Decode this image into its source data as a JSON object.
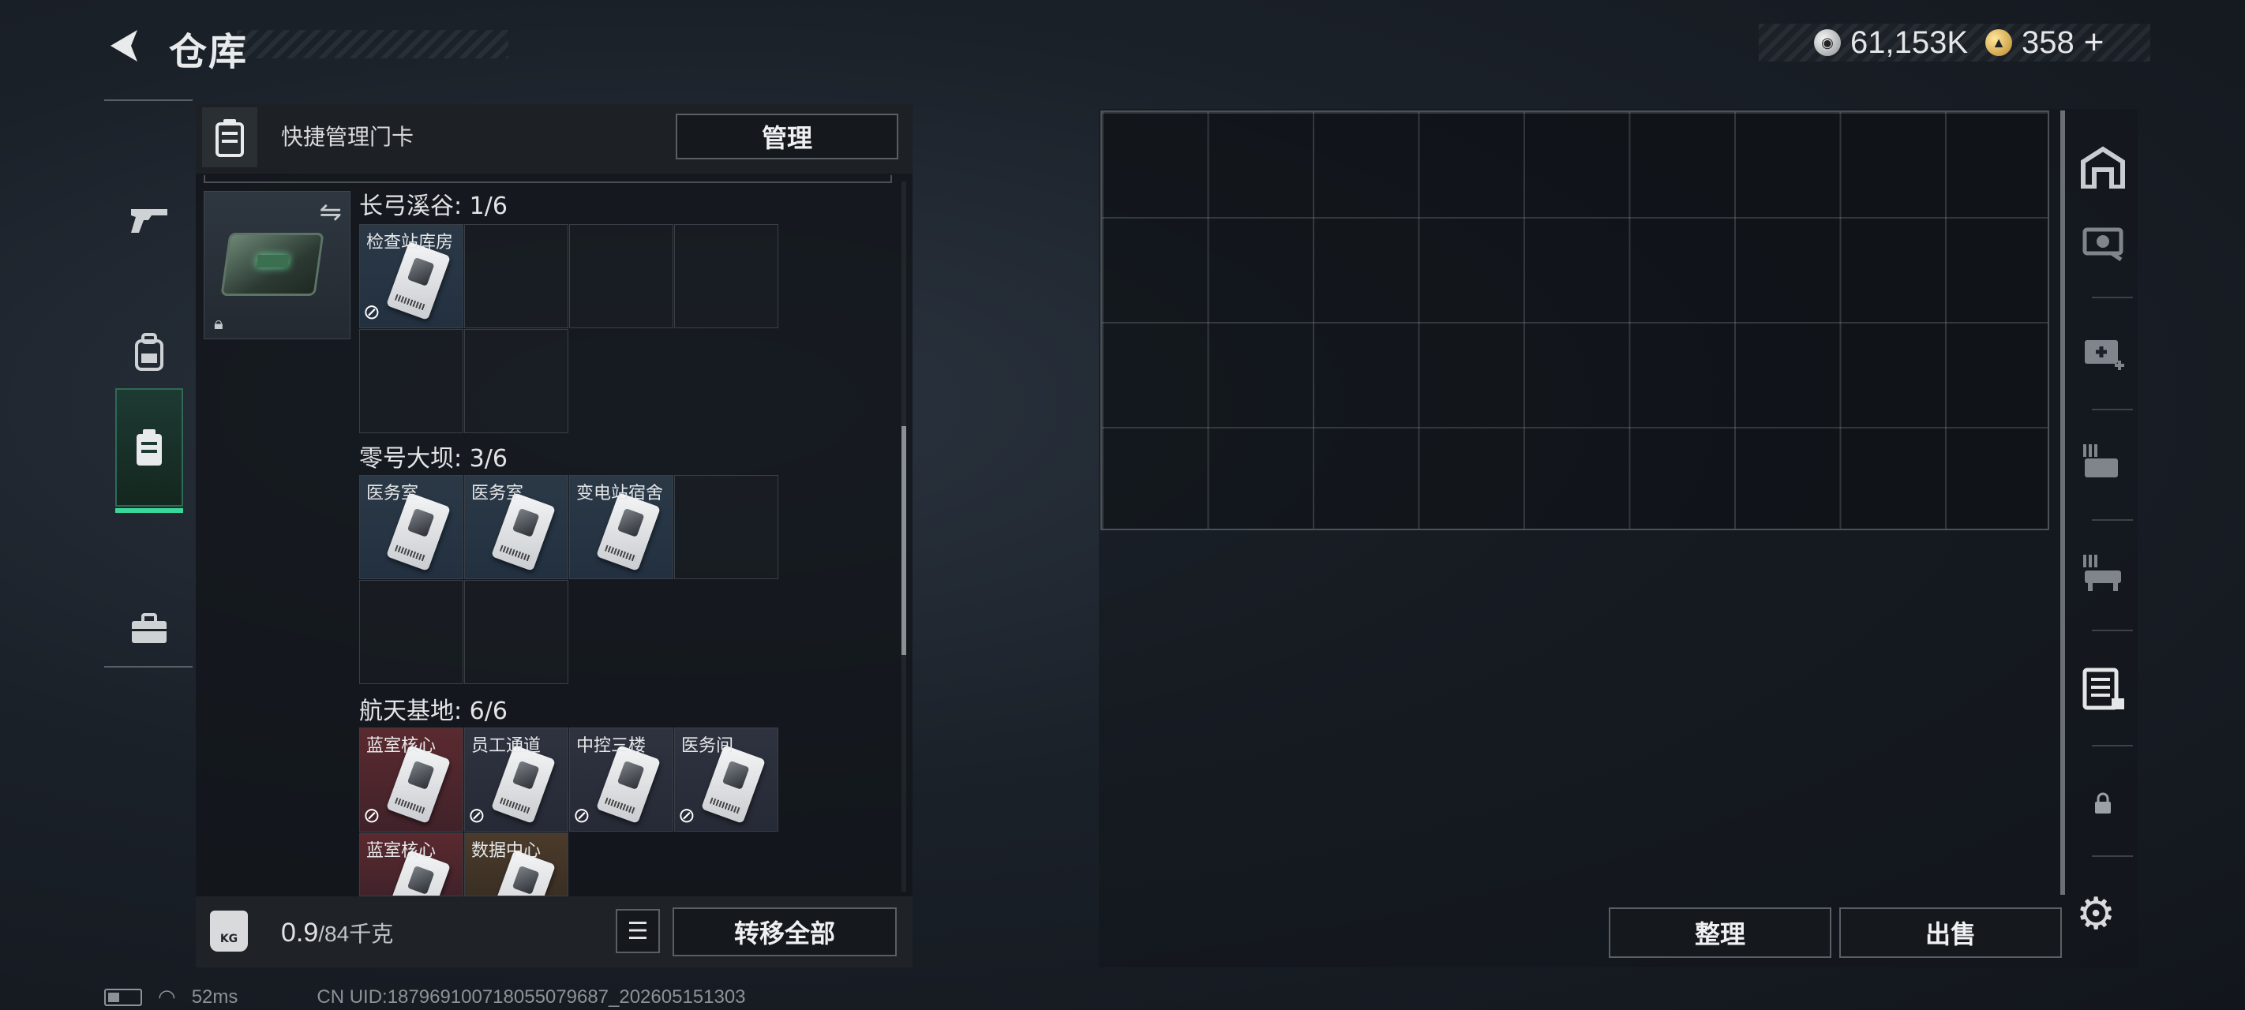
{
  "header": {
    "title": "仓库"
  },
  "currency": {
    "silver": "61,153K",
    "gold": "358",
    "gold_plus": "+"
  },
  "left_rail": {
    "items": [
      "pistol-icon",
      "backpack-icon",
      "keycard-case-icon",
      "toolbox-icon"
    ],
    "active": 2
  },
  "keycard_panel": {
    "header_label": "快捷管理门卡",
    "manage_label": "管理",
    "sections": [
      {
        "title": "长弓溪谷: 1/6",
        "cards": [
          "检查站库房"
        ]
      },
      {
        "title": "零号大坝: 3/6",
        "cards": [
          "医务室",
          "医务室",
          "变电站宿舍"
        ]
      },
      {
        "title": "航天基地: 6/6",
        "cards": [
          "蓝室核心",
          "员工通道",
          "中控三楼",
          "医务间",
          "蓝室核心",
          "数据中心"
        ]
      }
    ],
    "weight_value": "0.9",
    "weight_capacity": "/84千克",
    "weight_icon_text": "KG",
    "transfer_all_label": "转移全部"
  },
  "storage": {
    "sort_label": "整理",
    "sell_label": "出售"
  },
  "right_rail": {
    "items": [
      "warehouse-icon",
      "weapon-case-icon",
      "medkit-case-icon",
      "ammo-case-icon",
      "gear-case-icon",
      "card-case-icon",
      "lock-icon"
    ],
    "active": "card-case-icon"
  },
  "status_bar": {
    "ping": "52ms",
    "uid": "CN UID:18796910071805​5079687_202605151303"
  }
}
